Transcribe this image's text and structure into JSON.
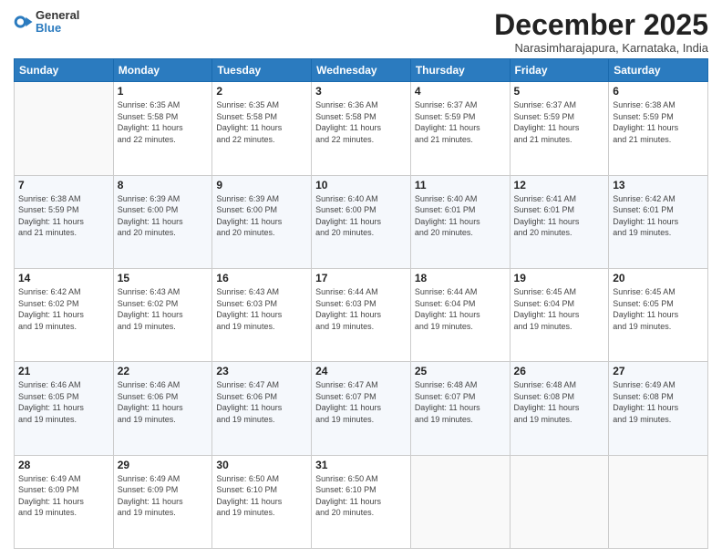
{
  "header": {
    "logo_line1": "General",
    "logo_line2": "Blue",
    "month_year": "December 2025",
    "location": "Narasimharajapura, Karnataka, India"
  },
  "days_of_week": [
    "Sunday",
    "Monday",
    "Tuesday",
    "Wednesday",
    "Thursday",
    "Friday",
    "Saturday"
  ],
  "weeks": [
    [
      {
        "day": "",
        "info": ""
      },
      {
        "day": "1",
        "info": "Sunrise: 6:35 AM\nSunset: 5:58 PM\nDaylight: 11 hours\nand 22 minutes."
      },
      {
        "day": "2",
        "info": "Sunrise: 6:35 AM\nSunset: 5:58 PM\nDaylight: 11 hours\nand 22 minutes."
      },
      {
        "day": "3",
        "info": "Sunrise: 6:36 AM\nSunset: 5:58 PM\nDaylight: 11 hours\nand 22 minutes."
      },
      {
        "day": "4",
        "info": "Sunrise: 6:37 AM\nSunset: 5:59 PM\nDaylight: 11 hours\nand 21 minutes."
      },
      {
        "day": "5",
        "info": "Sunrise: 6:37 AM\nSunset: 5:59 PM\nDaylight: 11 hours\nand 21 minutes."
      },
      {
        "day": "6",
        "info": "Sunrise: 6:38 AM\nSunset: 5:59 PM\nDaylight: 11 hours\nand 21 minutes."
      }
    ],
    [
      {
        "day": "7",
        "info": "Sunrise: 6:38 AM\nSunset: 5:59 PM\nDaylight: 11 hours\nand 21 minutes."
      },
      {
        "day": "8",
        "info": "Sunrise: 6:39 AM\nSunset: 6:00 PM\nDaylight: 11 hours\nand 20 minutes."
      },
      {
        "day": "9",
        "info": "Sunrise: 6:39 AM\nSunset: 6:00 PM\nDaylight: 11 hours\nand 20 minutes."
      },
      {
        "day": "10",
        "info": "Sunrise: 6:40 AM\nSunset: 6:00 PM\nDaylight: 11 hours\nand 20 minutes."
      },
      {
        "day": "11",
        "info": "Sunrise: 6:40 AM\nSunset: 6:01 PM\nDaylight: 11 hours\nand 20 minutes."
      },
      {
        "day": "12",
        "info": "Sunrise: 6:41 AM\nSunset: 6:01 PM\nDaylight: 11 hours\nand 20 minutes."
      },
      {
        "day": "13",
        "info": "Sunrise: 6:42 AM\nSunset: 6:01 PM\nDaylight: 11 hours\nand 19 minutes."
      }
    ],
    [
      {
        "day": "14",
        "info": "Sunrise: 6:42 AM\nSunset: 6:02 PM\nDaylight: 11 hours\nand 19 minutes."
      },
      {
        "day": "15",
        "info": "Sunrise: 6:43 AM\nSunset: 6:02 PM\nDaylight: 11 hours\nand 19 minutes."
      },
      {
        "day": "16",
        "info": "Sunrise: 6:43 AM\nSunset: 6:03 PM\nDaylight: 11 hours\nand 19 minutes."
      },
      {
        "day": "17",
        "info": "Sunrise: 6:44 AM\nSunset: 6:03 PM\nDaylight: 11 hours\nand 19 minutes."
      },
      {
        "day": "18",
        "info": "Sunrise: 6:44 AM\nSunset: 6:04 PM\nDaylight: 11 hours\nand 19 minutes."
      },
      {
        "day": "19",
        "info": "Sunrise: 6:45 AM\nSunset: 6:04 PM\nDaylight: 11 hours\nand 19 minutes."
      },
      {
        "day": "20",
        "info": "Sunrise: 6:45 AM\nSunset: 6:05 PM\nDaylight: 11 hours\nand 19 minutes."
      }
    ],
    [
      {
        "day": "21",
        "info": "Sunrise: 6:46 AM\nSunset: 6:05 PM\nDaylight: 11 hours\nand 19 minutes."
      },
      {
        "day": "22",
        "info": "Sunrise: 6:46 AM\nSunset: 6:06 PM\nDaylight: 11 hours\nand 19 minutes."
      },
      {
        "day": "23",
        "info": "Sunrise: 6:47 AM\nSunset: 6:06 PM\nDaylight: 11 hours\nand 19 minutes."
      },
      {
        "day": "24",
        "info": "Sunrise: 6:47 AM\nSunset: 6:07 PM\nDaylight: 11 hours\nand 19 minutes."
      },
      {
        "day": "25",
        "info": "Sunrise: 6:48 AM\nSunset: 6:07 PM\nDaylight: 11 hours\nand 19 minutes."
      },
      {
        "day": "26",
        "info": "Sunrise: 6:48 AM\nSunset: 6:08 PM\nDaylight: 11 hours\nand 19 minutes."
      },
      {
        "day": "27",
        "info": "Sunrise: 6:49 AM\nSunset: 6:08 PM\nDaylight: 11 hours\nand 19 minutes."
      }
    ],
    [
      {
        "day": "28",
        "info": "Sunrise: 6:49 AM\nSunset: 6:09 PM\nDaylight: 11 hours\nand 19 minutes."
      },
      {
        "day": "29",
        "info": "Sunrise: 6:49 AM\nSunset: 6:09 PM\nDaylight: 11 hours\nand 19 minutes."
      },
      {
        "day": "30",
        "info": "Sunrise: 6:50 AM\nSunset: 6:10 PM\nDaylight: 11 hours\nand 19 minutes."
      },
      {
        "day": "31",
        "info": "Sunrise: 6:50 AM\nSunset: 6:10 PM\nDaylight: 11 hours\nand 20 minutes."
      },
      {
        "day": "",
        "info": ""
      },
      {
        "day": "",
        "info": ""
      },
      {
        "day": "",
        "info": ""
      }
    ]
  ]
}
